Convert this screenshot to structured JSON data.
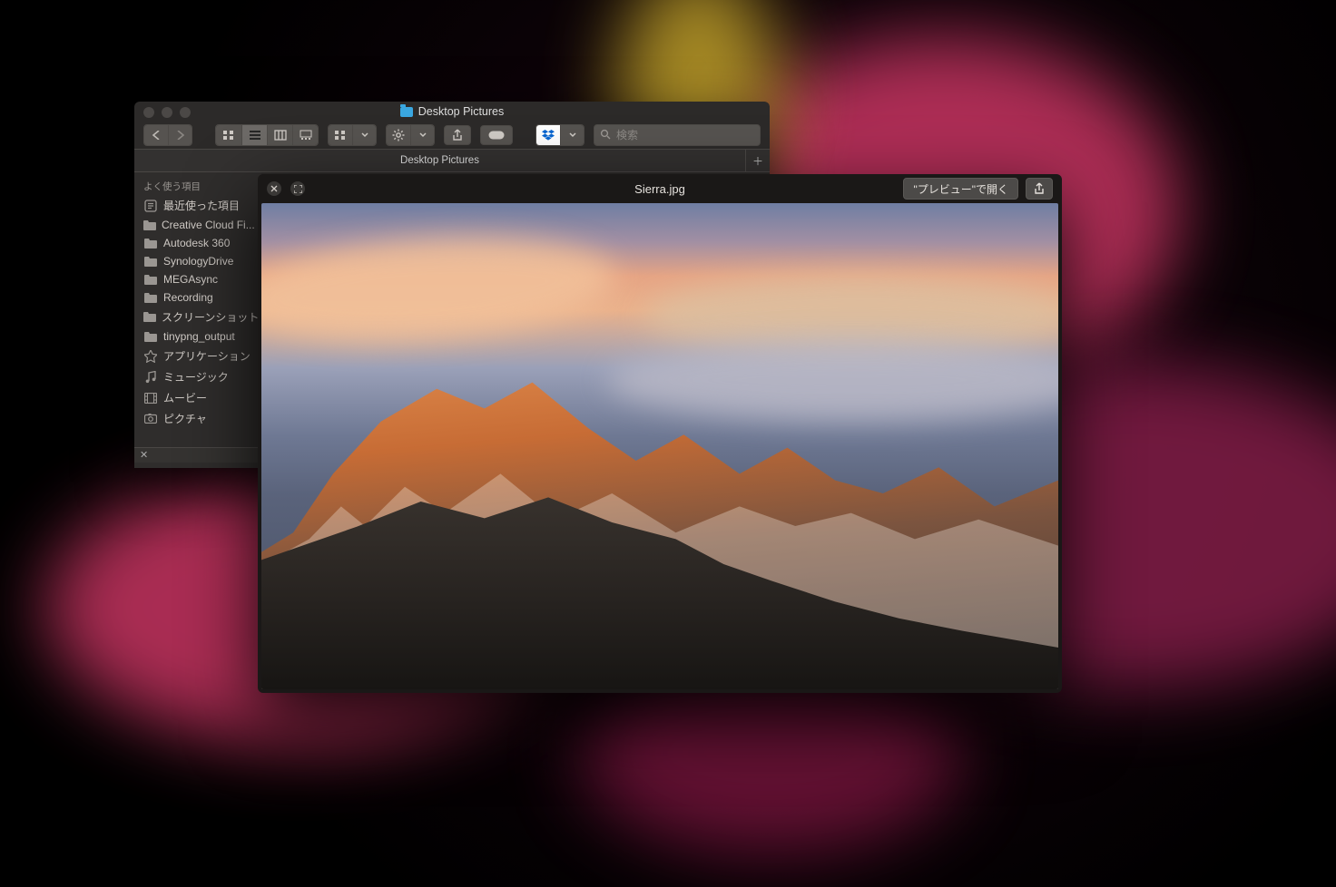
{
  "finder": {
    "window_title": "Desktop Pictures",
    "tab_label": "Desktop Pictures",
    "search_placeholder": "検索",
    "sidebar": {
      "header": "よく使う項目",
      "items": [
        {
          "icon": "recent",
          "label": "最近使った項目"
        },
        {
          "icon": "folder",
          "label": "Creative Cloud Fi..."
        },
        {
          "icon": "folder",
          "label": "Autodesk 360"
        },
        {
          "icon": "folder",
          "label": "SynologyDrive"
        },
        {
          "icon": "folder",
          "label": "MEGAsync"
        },
        {
          "icon": "folder",
          "label": "Recording"
        },
        {
          "icon": "folder",
          "label": "スクリーンショット"
        },
        {
          "icon": "folder",
          "label": "tinypng_output"
        },
        {
          "icon": "apps",
          "label": "アプリケーション"
        },
        {
          "icon": "music",
          "label": "ミュージック"
        },
        {
          "icon": "movie",
          "label": "ムービー"
        },
        {
          "icon": "pictures",
          "label": "ピクチャ"
        }
      ]
    }
  },
  "quicklook": {
    "filename": "Sierra.jpg",
    "open_button_label": "\"プレビュー\"で開く"
  }
}
